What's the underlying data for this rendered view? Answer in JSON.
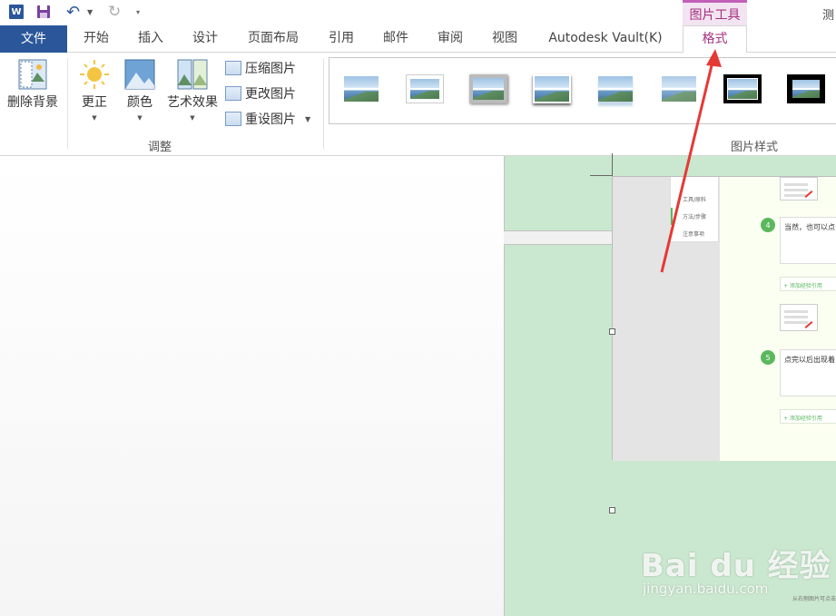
{
  "qat": {
    "word_logo": "W",
    "title_right": "测",
    "contextual_tab_group": "图片工具"
  },
  "tabs": [
    {
      "label": "文件"
    },
    {
      "label": "开始"
    },
    {
      "label": "插入"
    },
    {
      "label": "设计"
    },
    {
      "label": "页面布局"
    },
    {
      "label": "引用"
    },
    {
      "label": "邮件"
    },
    {
      "label": "审阅"
    },
    {
      "label": "视图"
    },
    {
      "label": "Autodesk Vault(K)"
    },
    {
      "label": "格式"
    }
  ],
  "ribbon": {
    "remove_background": "删除背景",
    "corrections": "更正",
    "color": "颜色",
    "artistic_effects": "艺术效果",
    "compress": "压缩图片",
    "change": "更改图片",
    "reset": "重设图片",
    "adjust_group": "调整",
    "styles_group": "图片样式"
  },
  "document_image": {
    "menu": [
      "工具/原料",
      "方法/步骤",
      "注意事项"
    ],
    "steps": [
      {
        "number": "4",
        "text": "当然，也可以点"
      },
      {
        "number": "5",
        "text": "点完以后出现着"
      }
    ],
    "add_reference": "+ 添加经验引用",
    "watermark": "Bai du 经验",
    "watermark_url": "jingyan.baidu.com",
    "watermark_note": "从右侧图片可点击"
  },
  "colors": {
    "file_tab": "#2b579a",
    "contextual_accent": "#a4317f",
    "page_green": "#cae8cf",
    "arrow": "#e53935"
  }
}
